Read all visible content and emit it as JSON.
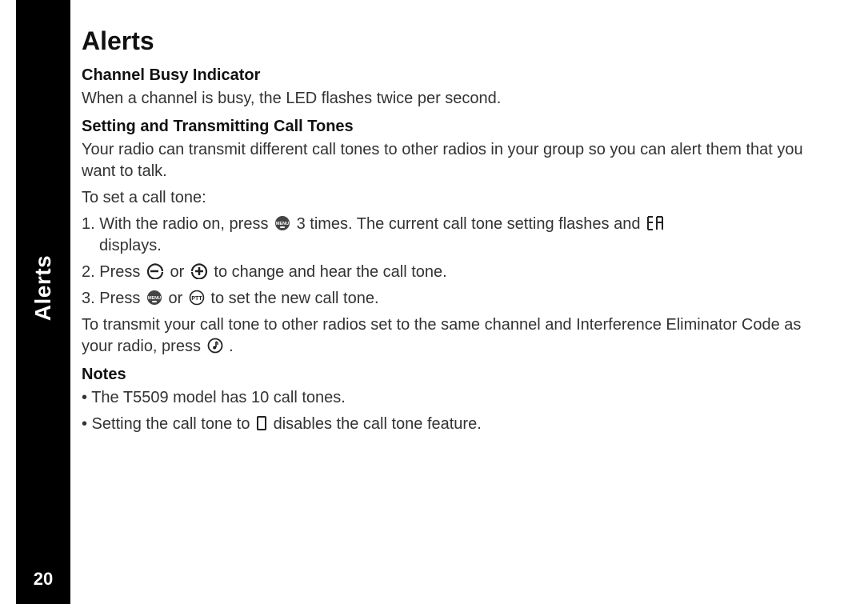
{
  "sidebar": {
    "tab": "Alerts",
    "pageNumber": "20"
  },
  "title": "Alerts",
  "sections": {
    "busy": {
      "heading": "Channel Busy Indicator",
      "body": "When a channel is busy, the LED flashes twice per second."
    },
    "tones": {
      "heading": "Setting and Transmitting Call Tones",
      "intro1": "Your radio can transmit different call tones to other radios in your group so you can alert them that you want to talk.",
      "intro2": "To set a call tone:",
      "step1_a": "1. With the radio on, press ",
      "step1_b": "3 times. The current call tone setting flashes and ",
      "step1_c": " displays.",
      "step2_a": "2. Press ",
      "step2_b": "or ",
      "step2_c": "to change and hear the call tone.",
      "step3_a": "3. Press ",
      "step3_b": "or ",
      "step3_c": "to set the new call tone.",
      "transmit_a": "To transmit your call tone to other radios set to the same channel and Interference Eliminator Code as your radio, press ",
      "transmit_b": "."
    },
    "notes": {
      "heading": "Notes",
      "n1": "• The T5509 model has 10 call tones.",
      "n2_a": "• Setting the call tone to ",
      "n2_b": " disables the call tone feature."
    }
  }
}
